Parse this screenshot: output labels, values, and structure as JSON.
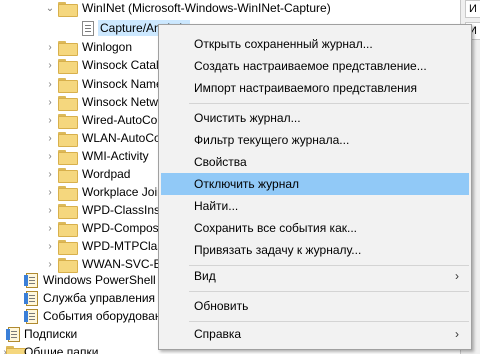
{
  "tree": {
    "items": [
      {
        "label": "WinINet (Microsoft-Windows-WinINet-Capture)",
        "expander": "⌄",
        "icon": "folder"
      },
      {
        "label": "Capture/Analytic",
        "expander": "",
        "icon": "log"
      },
      {
        "label": "Winlogon",
        "expander": "›",
        "icon": "folder"
      },
      {
        "label": "Winsock Catalog",
        "expander": "›",
        "icon": "folder"
      },
      {
        "label": "Winsock NameResolution",
        "expander": "›",
        "icon": "folder"
      },
      {
        "label": "Winsock Network Event",
        "expander": "›",
        "icon": "folder"
      },
      {
        "label": "Wired-AutoConfig",
        "expander": "›",
        "icon": "folder"
      },
      {
        "label": "WLAN-AutoConfig",
        "expander": "›",
        "icon": "folder"
      },
      {
        "label": "WMI-Activity",
        "expander": "›",
        "icon": "folder"
      },
      {
        "label": "Wordpad",
        "expander": "›",
        "icon": "folder"
      },
      {
        "label": "Workplace Join",
        "expander": "›",
        "icon": "folder"
      },
      {
        "label": "WPD-ClassInstaller",
        "expander": "›",
        "icon": "folder"
      },
      {
        "label": "WPD-CompositeClassDriver",
        "expander": "›",
        "icon": "folder"
      },
      {
        "label": "WPD-MTPClassDriver",
        "expander": "›",
        "icon": "folder"
      },
      {
        "label": "WWAN-SVC-Events",
        "expander": "›",
        "icon": "folder"
      },
      {
        "label": "Windows PowerShell",
        "expander": "",
        "icon": "log-color"
      },
      {
        "label": "Служба управления ключами",
        "expander": "",
        "icon": "log-color"
      },
      {
        "label": "События оборудования",
        "expander": "",
        "icon": "log-color"
      },
      {
        "label": "Подписки",
        "expander": "",
        "icon": "log-color"
      },
      {
        "label": "Общие папки",
        "expander": "›",
        "icon": "folder"
      }
    ]
  },
  "right_panel": {
    "item1": "И",
    "item2": "И"
  },
  "context_menu": {
    "items": [
      {
        "label": "Открыть сохраненный журнал..."
      },
      {
        "label": "Создать настраиваемое представление..."
      },
      {
        "label": "Импорт настраиваемого представления"
      },
      {
        "label": "Очистить журнал..."
      },
      {
        "label": "Фильтр текущего журнала..."
      },
      {
        "label": "Свойства"
      },
      {
        "label": "Отключить журнал"
      },
      {
        "label": "Найти..."
      },
      {
        "label": "Сохранить все события как..."
      },
      {
        "label": "Привязать задачу к журналу..."
      },
      {
        "label": "Вид",
        "submenu_arrow": "›"
      },
      {
        "label": "Обновить"
      },
      {
        "label": "Справка",
        "submenu_arrow": "›"
      }
    ],
    "highlighted": "Отключить журнал",
    "highlight_color": "#91c9f7"
  }
}
